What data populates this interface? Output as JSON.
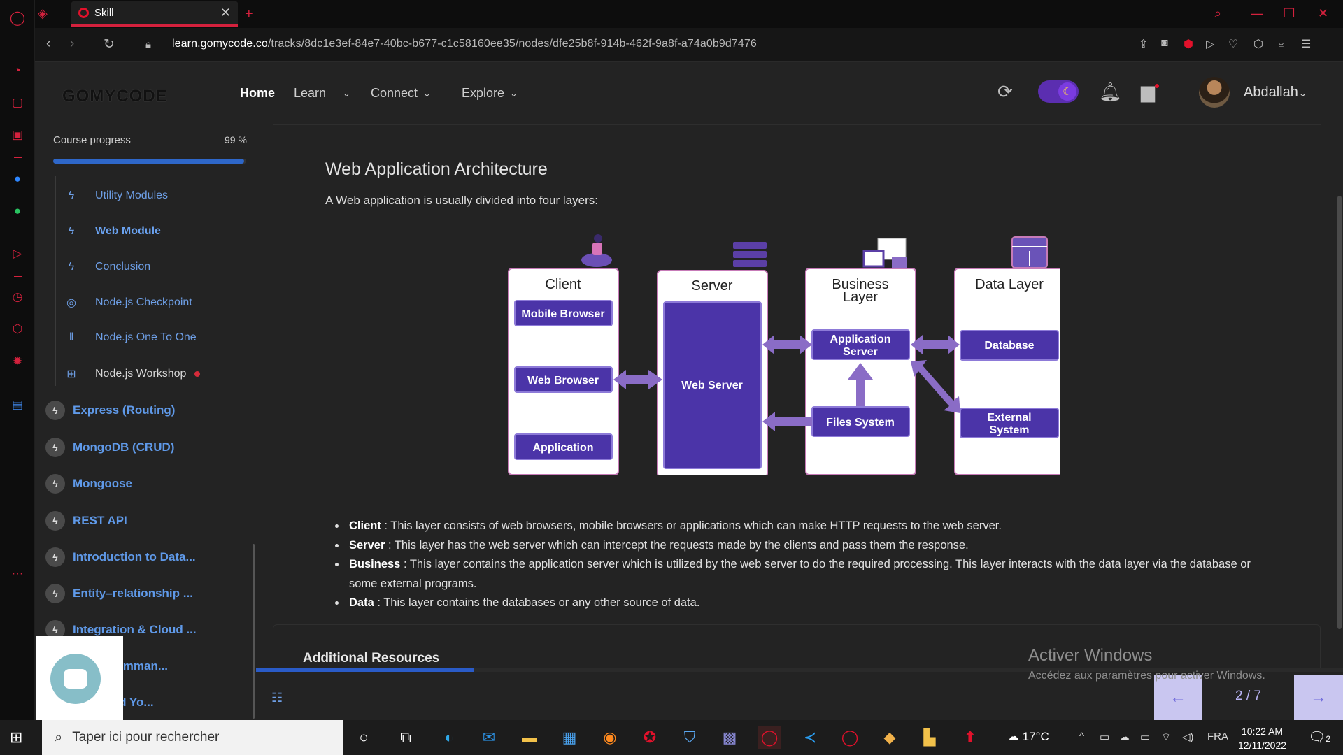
{
  "browser": {
    "tab_title": "Skill",
    "url_domain": "learn.gomycode.co",
    "url_path": "/tracks/8dc1e3ef-84e7-40bc-b677-c1c58160ee35/nodes/dfe25b8f-914b-462f-9a8f-a74a0b9d7476"
  },
  "header": {
    "logo": "GOMYCODE",
    "nav": [
      {
        "label": "Home"
      },
      {
        "label": "Learn"
      },
      {
        "label": "Connect"
      },
      {
        "label": "Explore"
      }
    ],
    "username": "Abdallah"
  },
  "sidebar": {
    "progress_label": "Course progress",
    "progress_value": "99 %",
    "progress_fraction": 0.99,
    "sub_items": [
      {
        "label": "Utility Modules",
        "icon": "bolt-icon"
      },
      {
        "label": "Web Module",
        "icon": "bolt-icon"
      },
      {
        "label": "Conclusion",
        "icon": "bolt-icon"
      },
      {
        "label": "Node.js Checkpoint",
        "icon": "target-icon"
      },
      {
        "label": "Node.js One To One",
        "icon": "people-icon"
      },
      {
        "label": "Node.js Workshop",
        "icon": "workshop-icon"
      }
    ],
    "modules": [
      {
        "label": "Express (Routing)"
      },
      {
        "label": "MongoDB (CRUD)"
      },
      {
        "label": "Mongoose"
      },
      {
        "label": "REST API"
      },
      {
        "label": "Introduction to Data..."
      },
      {
        "label": "Entity–relationship ..."
      },
      {
        "label": "Integration & Cloud ..."
      },
      {
        "label": "Flow (Comman..."
      },
      {
        "label": "se : Build Yo..."
      }
    ]
  },
  "lesson": {
    "title": "Web Application Architecture",
    "intro": "A Web application is usually divided into four layers:",
    "diagram": {
      "client": {
        "title": "Client",
        "boxes": [
          "Mobile Browser",
          "Web Browser",
          "Application"
        ]
      },
      "server": {
        "title": "Server",
        "box": "Web Server"
      },
      "business": {
        "title1": "Business",
        "title2": "Layer",
        "app1": "Application",
        "app2": "Server",
        "files": "Files System"
      },
      "data": {
        "title": "Data Layer",
        "db": "Database",
        "ext1": "External",
        "ext2": "System"
      }
    },
    "bullets": [
      {
        "term": "Client",
        "text": " : This layer consists of web browsers, mobile browsers or applications which can make HTTP requests to the web server."
      },
      {
        "term": "Server",
        "text": " : This layer has the web server which can intercept the requests made by the clients and pass them the response."
      },
      {
        "term": "Business",
        "text": " : This layer contains the application server which is utilized by the web server to do the required processing. This layer interacts with the data layer via the database or some external programs."
      },
      {
        "term": "Data",
        "text": " : This layer contains the databases or any other source of data."
      }
    ],
    "resources_title": "Additional Resources"
  },
  "pager": {
    "counter": "2 / 7",
    "progress_fraction": 0.2,
    "prev": "←",
    "next": "→"
  },
  "watermark": {
    "line1": "Activer Windows",
    "line2": "Accédez aux paramètres pour activer Windows."
  },
  "taskbar": {
    "search_placeholder": "Taper ici pour rechercher",
    "weather": "17°C",
    "language": "FRA",
    "time": "10:22 AM",
    "date": "12/11/2022",
    "notifications": "2"
  },
  "colors": {
    "accent_red": "#e2112b",
    "link_blue": "#5f99e8",
    "diagram_purple": "#4b34a8"
  }
}
